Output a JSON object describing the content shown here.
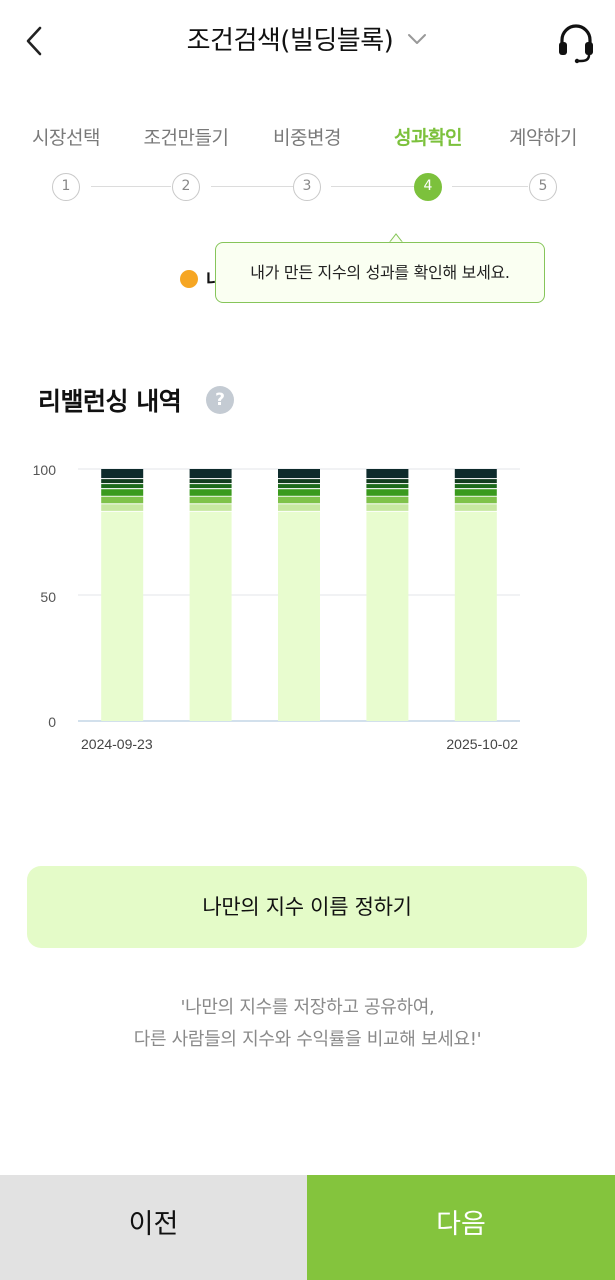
{
  "header": {
    "title": "조건검색(빌딩블록)",
    "back_icon": "chevron-left-icon",
    "dropdown_icon": "chevron-down-icon",
    "support_icon": "headset-icon"
  },
  "steps": [
    {
      "label": "시장선택",
      "number": "1",
      "active": false
    },
    {
      "label": "조건만들기",
      "number": "2",
      "active": false
    },
    {
      "label": "비중변경",
      "number": "3",
      "active": false
    },
    {
      "label": "성과확인",
      "number": "4",
      "active": true
    },
    {
      "label": "계약하기",
      "number": "5",
      "active": false
    }
  ],
  "legend": {
    "label": "내",
    "color": "#f6a623"
  },
  "tooltip": {
    "text": "내가 만든 지수의 성과를 확인해 보세요."
  },
  "rebalance": {
    "title": "리밸런싱 내역",
    "help_symbol": "?"
  },
  "chart_data": {
    "type": "bar",
    "stacked": true,
    "ylim": [
      0,
      100
    ],
    "y_ticks": [
      "100",
      "50",
      "0"
    ],
    "x_tick_labels": [
      "2024-09-23",
      "2025-10-02"
    ],
    "bar_count": 5,
    "grid": true,
    "series": [
      {
        "values": [
          83,
          83,
          83,
          83,
          83
        ],
        "color": "#e8fccf"
      },
      {
        "values": [
          3,
          3,
          3,
          3,
          3
        ],
        "color": "#c8e8a2"
      },
      {
        "values": [
          3,
          3,
          3,
          3,
          3
        ],
        "color": "#7fc24a"
      },
      {
        "values": [
          3,
          3,
          3,
          3,
          3
        ],
        "color": "#3a9a1d"
      },
      {
        "values": [
          2,
          2,
          2,
          2,
          2
        ],
        "color": "#1c6a1a"
      },
      {
        "values": [
          2,
          2,
          2,
          2,
          2
        ],
        "color": "#123d1f"
      },
      {
        "values": [
          4,
          4,
          4,
          4,
          4
        ],
        "color": "#0e2b2c"
      }
    ]
  },
  "name_button": {
    "label": "나만의 지수 이름 정하기"
  },
  "note": {
    "line1": "'나만의 지수를 저장하고 공유하여,",
    "line2": "다른 사람들의 지수와 수익률을 비교해 보세요!'"
  },
  "footer": {
    "prev_label": "이전",
    "next_label": "다음"
  }
}
